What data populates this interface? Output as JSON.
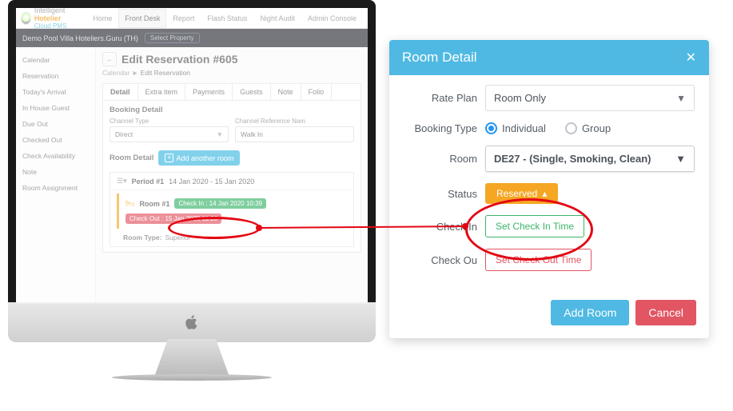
{
  "brand": {
    "word1": "Intelligent",
    "word2": "Hotelier",
    "sub": "Cloud PMS"
  },
  "nav": {
    "home": "Home",
    "frontdesk": "Front Desk",
    "report": "Report",
    "flash": "Flash Status",
    "night": "Night Audit",
    "admin": "Admin Console"
  },
  "propertyBar": {
    "name": "Demo Pool Villa Hoteliers.Guru (TH)",
    "select": "Select Property"
  },
  "sidebar": {
    "items": [
      "Calendar",
      "Reservation",
      "Today's Arrival",
      "In House Guest",
      "Due Out",
      "Checked Out",
      "Check Availability",
      "Note",
      "Room Assignment"
    ]
  },
  "page": {
    "title": "Edit Reservation #605",
    "bc1": "Calendar",
    "bcsep": "►",
    "bc2": "Edit Reservation",
    "tabs": [
      "Detail",
      "Extra item",
      "Payments",
      "Guests",
      "Note",
      "Folio"
    ],
    "booking_h": "Booking Detail",
    "channel_lbl": "Channel Type",
    "channel_val": "Direct",
    "ref_lbl": "Channel Reference Nam",
    "ref_val": "Walk In",
    "room_detail_h": "Room Detail",
    "add_room_btn": "Add another room",
    "period_label": "Period #1",
    "period_dates": "14 Jan 2020 - 15 Jan 2020",
    "room_label": "Room #1",
    "checkin_chip": "Check In : 14 Jan 2020 10:39",
    "checkout_chip": "Check Out : 15 Jan 2020 11:20",
    "roomtype_lbl": "Room Type:",
    "roomtype_val": "Superior"
  },
  "modal": {
    "title": "Room Detail",
    "rateplan_lbl": "Rate Plan",
    "rateplan_val": "Room Only",
    "bookingtype_lbl": "Booking Type",
    "opt_individual": "Individual",
    "opt_group": "Group",
    "room_lbl": "Room",
    "room_val": "DE27 - (Single, Smoking, Clean)",
    "status_lbl": "Status",
    "status_val": "Reserved",
    "checkin_lbl": "Check In",
    "checkin_btn": "Set Check In Time",
    "checkout_lbl": "Check Ou",
    "checkout_btn": "Set Check Out Time",
    "add_btn": "Add Room",
    "cancel_btn": "Cancel"
  }
}
